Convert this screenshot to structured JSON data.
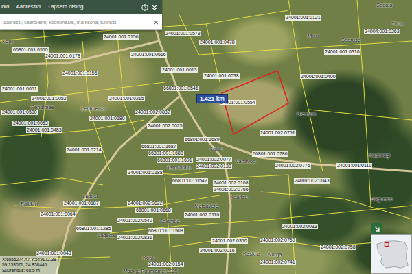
{
  "header": {
    "tabs": [
      {
        "label": "ihid",
        "selected": false
      },
      {
        "label": "Aadressid",
        "selected": false
      },
      {
        "label": "Täpsem otsing",
        "selected": false
      }
    ]
  },
  "search": {
    "placeholder": "aadressi, kaardilehti, koordinaate, märksõna, tunnust",
    "clear": "×"
  },
  "measure": {
    "label": "1.421 km"
  },
  "parcels": [
    "24001:001:0156",
    "66801:001:0550",
    "24001:001:0178",
    "24001:001:0573",
    "24001:001:0478",
    "24001:001:0616",
    "24001:001:0121",
    "24001:001:0310",
    "24004:001:0263",
    "24001:001:0013",
    "24001:001:0038",
    "24001:001:0400",
    "24001:001:0155",
    "24001:001:0051",
    "24001:001:0052",
    "66801:001:0546",
    "24001:001:0215",
    "24001:001:0554",
    "24001:002:0832",
    "24001:001:0180",
    "24001:001:0053",
    "24001:001:0483",
    "24001:002:0025",
    "24001:002:0751",
    "24001:001:0214",
    "66801:001:1689",
    "66801:001:1687",
    "66801:001:1688",
    "66801:001:1691",
    "24001:002:0077",
    "24001:002:0138",
    "66801:001:0286",
    "24001:002:0775",
    "24001:001:0110",
    "24001:001:0188",
    "66801:001:0542",
    "24001:002:0108",
    "24001:002:0043",
    "24001:002:0766",
    "24001:001:0187",
    "24001:002:0822",
    "66801:001:0668",
    "24001:002:0116",
    "24001:001:0064",
    "24001:002:0540",
    "66801:001:1285",
    "24001:002:0831",
    "66801:001:1508",
    "24001:002:0033",
    "24001:002:0350",
    "24001:002:0759",
    "24001:002:0758",
    "24001:002:0741",
    "24001:001:0043",
    "24001:002:0154",
    "24001:002:0016",
    "24001:001:0580"
  ],
  "places": [
    "Kopli",
    "Miku",
    "Saaruse",
    "Sadala",
    "Tõnu",
    "Pendimäe",
    "Lehtmetsa",
    "Tarovatalu",
    "Kaldu",
    "Vanavoo",
    "Ülemeta",
    "Kapimägi",
    "Lepiku",
    "Paltikivi",
    "Lageda",
    "Metsavere",
    "Kaarisu",
    "Kalamäe",
    "Kaskna",
    "Nurga",
    "Kopli",
    "Sõgumäe"
  ],
  "coordinates": [
    "X:6555274.47 Y:549172.38",
    "59.153071, 24.858446",
    "Suurendus: 68.5 m"
  ],
  "credit": "Maa- ja Ruumiamet 2025"
}
